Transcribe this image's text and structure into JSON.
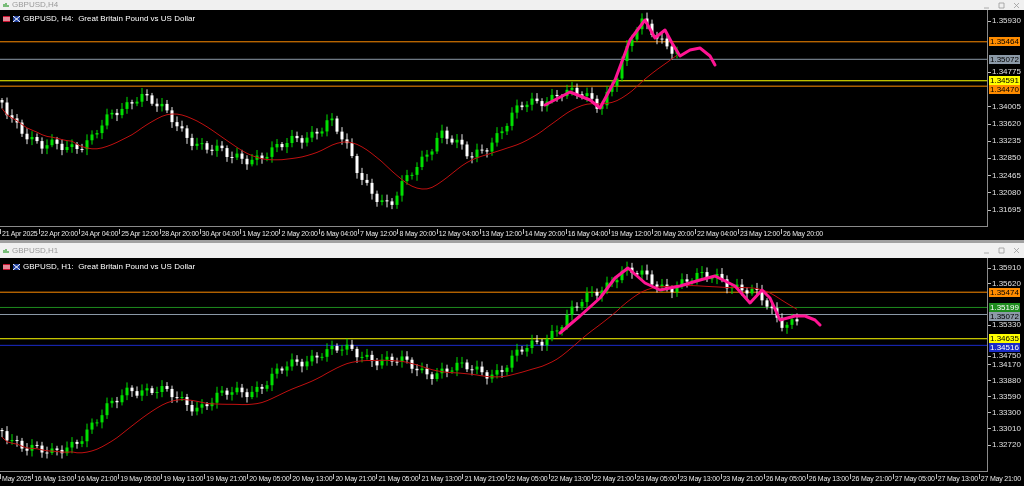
{
  "windows": [
    {
      "title": "GBPUSD,H4",
      "chart": {
        "header": "GBPUSD, H4:  Great Britain Pound vs US Dollar",
        "price_ticks": [
          "1.35930",
          "1.34775",
          "1.34005",
          "1.33620",
          "1.33235",
          "1.32850",
          "1.32465",
          "1.32080",
          "1.31695"
        ],
        "levels": [
          {
            "label": "1.35464",
            "color": "#ff8c00"
          },
          {
            "label": "1.35072",
            "color": "#8c9aa8"
          },
          {
            "label": "1.34591",
            "color": "#ffff00"
          },
          {
            "label": "1.34470",
            "color": "#ff8c00"
          }
        ],
        "time_labels": [
          "21 Apr 2025",
          "22 Apr 20:00",
          "24 Apr 04:00",
          "25 Apr 12:00",
          "28 Apr 20:00",
          "30 Apr 04:00",
          "1 May 12:00",
          "2 May 20:00",
          "6 May 04:00",
          "7 May 12:00",
          "8 May 20:00",
          "12 May 04:00",
          "13 May 12:00",
          "14 May 20:00",
          "16 May 04:00",
          "19 May 12:00",
          "20 May 20:00",
          "22 May 04:00",
          "23 May 12:00",
          "26 May 20:00"
        ]
      }
    },
    {
      "title": "GBPUSD,H1",
      "chart": {
        "header": "GBPUSD, H1:  Great Britain Pound vs US Dollar",
        "price_ticks": [
          "1.35910",
          "1.35620",
          "1.35330",
          "1.34750",
          "1.34170",
          "1.33880",
          "1.33590",
          "1.33300",
          "1.33010",
          "1.32720"
        ],
        "levels": [
          {
            "label": "1.35474",
            "color": "#ff8c00"
          },
          {
            "label": "1.35199",
            "color": "#1e8c1e"
          },
          {
            "label": "1.35072",
            "color": "#8c9aa8"
          },
          {
            "label": "1.34635",
            "color": "#ffff00"
          },
          {
            "label": "1.34516",
            "color": "#1a2bc8"
          }
        ],
        "time_labels": [
          "May 2025",
          "16 May 13:00",
          "16 May 21:00",
          "19 May 05:00",
          "19 May 13:00",
          "19 May 21:00",
          "20 May 05:00",
          "20 May 13:00",
          "20 May 21:00",
          "21 May 05:00",
          "21 May 13:00",
          "21 May 21:00",
          "22 May 05:00",
          "22 May 13:00",
          "22 May 21:00",
          "23 May 05:00",
          "23 May 13:00",
          "23 May 21:00",
          "26 May 05:00",
          "26 May 13:00",
          "26 May 21:00",
          "27 May 05:00",
          "27 May 13:00",
          "27 May 21:00"
        ]
      }
    }
  ]
}
